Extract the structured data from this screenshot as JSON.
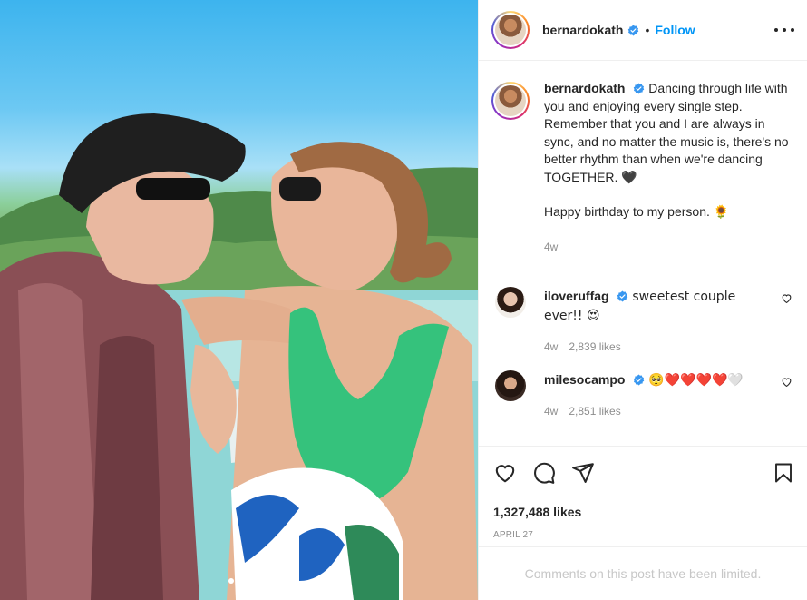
{
  "post": {
    "username": "bernardokath",
    "follow_label": "Follow",
    "separator": "•",
    "caption_text": "Dancing through life with you and enjoying every single step. Remember that you and I are always in sync, and no matter the music is, there's no better rhythm than when we're dancing TOGETHER. 🖤",
    "caption_text2": "Happy birthday to my person. 🌻",
    "caption_age": "4w",
    "likes": "1,327,488 likes",
    "date": "APRIL 27",
    "limited_notice": "Comments on this post have been limited."
  },
  "comments": [
    {
      "username": "iloveruffag",
      "text": "sweetest couple ever!! 😍",
      "age": "4w",
      "likes": "2,839 likes"
    },
    {
      "username": "milesocampo",
      "text": "🥺❤️❤️❤️❤️🤍",
      "age": "4w",
      "likes": "2,851 likes"
    }
  ],
  "icons": {
    "verified": "verified-badge-icon",
    "more": "more-options-icon",
    "like": "heart-icon",
    "comment": "comment-icon",
    "share": "share-icon",
    "save": "bookmark-icon"
  },
  "colors": {
    "link": "#0095f6",
    "verified": "#3897f0",
    "muted": "#8e8e8e"
  },
  "carousel": {
    "current": 1,
    "total": 2
  }
}
